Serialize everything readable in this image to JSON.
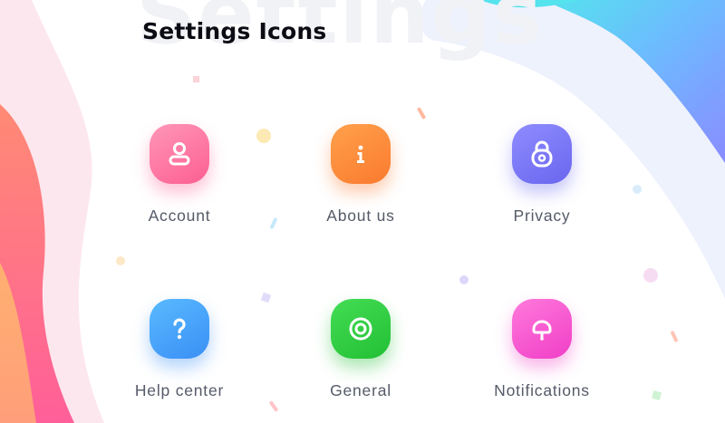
{
  "page": {
    "title": "Settings Icons",
    "watermark": "Settings"
  },
  "settings": {
    "items": [
      {
        "label": "Account",
        "icon": "account-icon",
        "color": "#fc5f91"
      },
      {
        "label": "About us",
        "icon": "info-icon",
        "color": "#fa7a2e"
      },
      {
        "label": "Privacy",
        "icon": "lock-icon",
        "color": "#6a66ef"
      },
      {
        "label": "Help center",
        "icon": "help-icon",
        "color": "#3a8ff5"
      },
      {
        "label": "General",
        "icon": "target-icon",
        "color": "#22bf34"
      },
      {
        "label": "Notifications",
        "icon": "bell-icon",
        "color": "#f03ec7"
      }
    ]
  },
  "colors": {
    "title": "#0c0c14",
    "label": "#555a68",
    "background": "#ffffff"
  }
}
